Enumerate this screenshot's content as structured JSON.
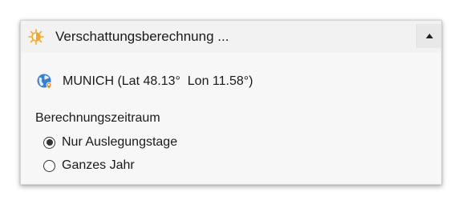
{
  "header": {
    "title": "Verschattungsberechnung ...",
    "icon": "sun-icon",
    "collapse_icon": "chevron-up-icon",
    "icon_color": "#f5a623"
  },
  "location": {
    "icon": "globe-location-icon",
    "text": "MUNICH (Lat 48.13°  Lon 11.58°)"
  },
  "calculation_period": {
    "label": "Berechnungszeitraum",
    "options": [
      {
        "label": "Nur Auslegungstage",
        "selected": true
      },
      {
        "label": "Ganzes Jahr",
        "selected": false
      }
    ]
  }
}
